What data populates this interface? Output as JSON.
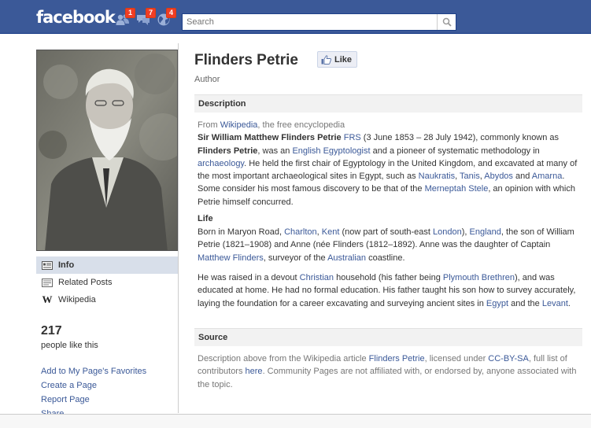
{
  "topbar": {
    "logo": "facebook",
    "friend_requests_badge": "1",
    "messages_badge": "7",
    "notifications_badge": "4",
    "search_placeholder": "Search",
    "bg_color": "#3b5998"
  },
  "sidebar": {
    "nav": [
      {
        "label": "Info",
        "icon": "info-icon",
        "active": true
      },
      {
        "label": "Related Posts",
        "icon": "posts-icon",
        "active": false
      },
      {
        "label": "Wikipedia",
        "icon": "wikipedia-icon",
        "active": false
      }
    ],
    "likes_count": "217",
    "likes_label": "people like this",
    "links": [
      "Add to My Page's Favorites",
      "Create a Page",
      "Report Page",
      "Share"
    ]
  },
  "page": {
    "title": "Flinders Petrie",
    "like_label": "Like",
    "category": "Author"
  },
  "description": {
    "header": "Description",
    "from_prefix": "From ",
    "from_link": "Wikipedia",
    "from_suffix": ", the free encyclopedia",
    "p1": {
      "name": "Sir William Matthew Flinders Petrie",
      "frs": "FRS",
      "t1": " (3 June 1853 – 28 July 1942), commonly known as ",
      "known_as": "Flinders Petrie",
      "t2": ", was an ",
      "l_english": "English",
      "t3": " ",
      "l_egyptologist": "Egyptologist",
      "t4": " and a pioneer of systematic methodology in ",
      "l_archaeology": "archaeology",
      "t5": ". He held the first chair of Egyptology in the United Kingdom, and excavated at many of the most important archaeological sites in Egypt, such as ",
      "l_naukratis": "Naukratis",
      "t6": ", ",
      "l_tanis": "Tanis",
      "t7": ", ",
      "l_abydos": "Abydos",
      "t8": " and ",
      "l_amarna": "Amarna",
      "t9": ". Some consider his most famous discovery to be that of the ",
      "l_stele": "Merneptah Stele",
      "t10": ", an opinion with which Petrie himself concurred."
    }
  },
  "life": {
    "header": "Life",
    "p1": {
      "t1": "Born in Maryon Road, ",
      "l_charlton": "Charlton",
      "t2": ", ",
      "l_kent": "Kent",
      "t3": " (now part of south-east ",
      "l_london": "London",
      "t4": "), ",
      "l_england": "England",
      "t5": ", the son of William Petrie (1821–1908) and Anne (née Flinders (1812–1892). Anne was the daughter of Captain ",
      "l_matthew": "Matthew Flinders",
      "t6": ", surveyor of the ",
      "l_australian": "Australian",
      "t7": " coastline."
    },
    "p2": {
      "t1": "He was raised in a devout ",
      "l_christian": "Christian",
      "t2": " household (his father being ",
      "l_plymouth": "Plymouth Brethren",
      "t3": "), and was educated at home. He had no formal education. His father taught his son how to survey accurately, laying the foundation for a career excavating and surveying ancient sites in ",
      "l_egypt": "Egypt",
      "t4": " and the ",
      "l_levant": "Levant",
      "t5": "."
    }
  },
  "source": {
    "header": "Source",
    "t1": "Description above from the Wikipedia article ",
    "l_article": "Flinders Petrie",
    "t2": ", licensed under ",
    "l_license": "CC-BY-SA",
    "t3": ", full list of contributors ",
    "l_here": "here",
    "t4": ". Community Pages are not affiliated with, or endorsed by, anyone associated with the topic."
  }
}
